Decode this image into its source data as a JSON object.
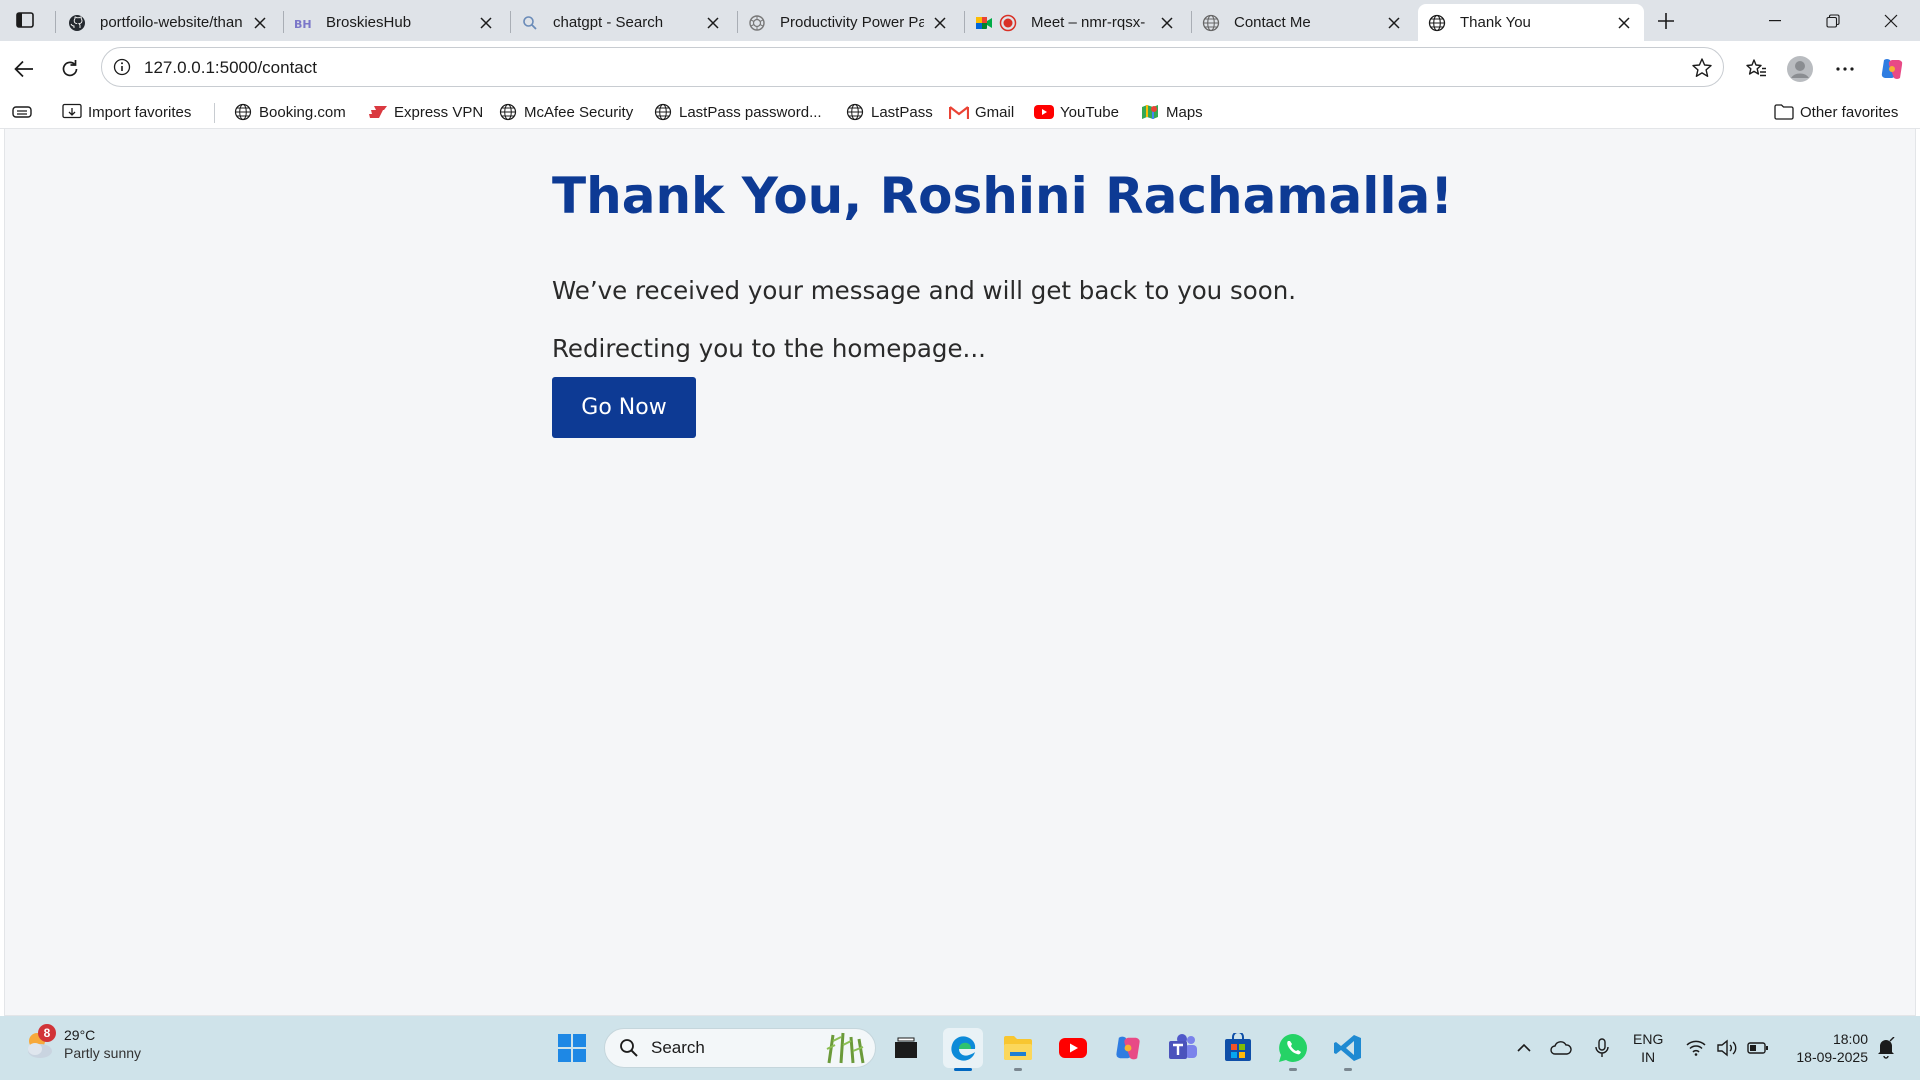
{
  "browser": {
    "tabs": [
      {
        "title": "portfoilo-website/than",
        "favicon": "github-icon",
        "active": false
      },
      {
        "title": "BroskiesHub",
        "favicon": "broskieshub-icon",
        "active": false
      },
      {
        "title": "chatgpt - Search",
        "favicon": "search-icon",
        "active": false
      },
      {
        "title": "Productivity Power Pac",
        "favicon": "chatgpt-icon",
        "active": false
      },
      {
        "title": "Meet – nmr-rqsx-",
        "favicon": "google-meet-icon",
        "active": false,
        "recording": true
      },
      {
        "title": "Contact Me",
        "favicon": "globe-icon",
        "active": false
      },
      {
        "title": "Thank You",
        "favicon": "globe-icon",
        "active": true
      }
    ],
    "address_bar": {
      "url": "127.0.0.1:5000/contact"
    },
    "favorites": [
      {
        "label": "Import favorites",
        "icon": "import-icon"
      },
      {
        "label": "Booking.com",
        "icon": "globe-icon"
      },
      {
        "label": "Express VPN",
        "icon": "expressvpn-icon"
      },
      {
        "label": "McAfee Security",
        "icon": "globe-icon"
      },
      {
        "label": "LastPass password...",
        "icon": "globe-icon"
      },
      {
        "label": "LastPass",
        "icon": "globe-icon"
      },
      {
        "label": "Gmail",
        "icon": "gmail-icon"
      },
      {
        "label": "YouTube",
        "icon": "youtube-icon"
      },
      {
        "label": "Maps",
        "icon": "maps-icon"
      }
    ],
    "other_favorites": "Other favorites"
  },
  "page": {
    "title": "Thank You, Roshini Rachamalla!",
    "message": "We’ve received your message and will get back to you soon.",
    "redirect_text": "Redirecting you to the homepage...",
    "button_label": "Go Now",
    "colors": {
      "primary": "#0d3a94",
      "background": "#f5f6f8"
    }
  },
  "taskbar": {
    "weather": {
      "badge": "8",
      "temp": "29°C",
      "condition": "Partly sunny"
    },
    "search_label": "Search",
    "language": {
      "line1": "ENG",
      "line2": "IN"
    },
    "clock": {
      "time": "18:00",
      "date": "18-09-2025"
    }
  }
}
